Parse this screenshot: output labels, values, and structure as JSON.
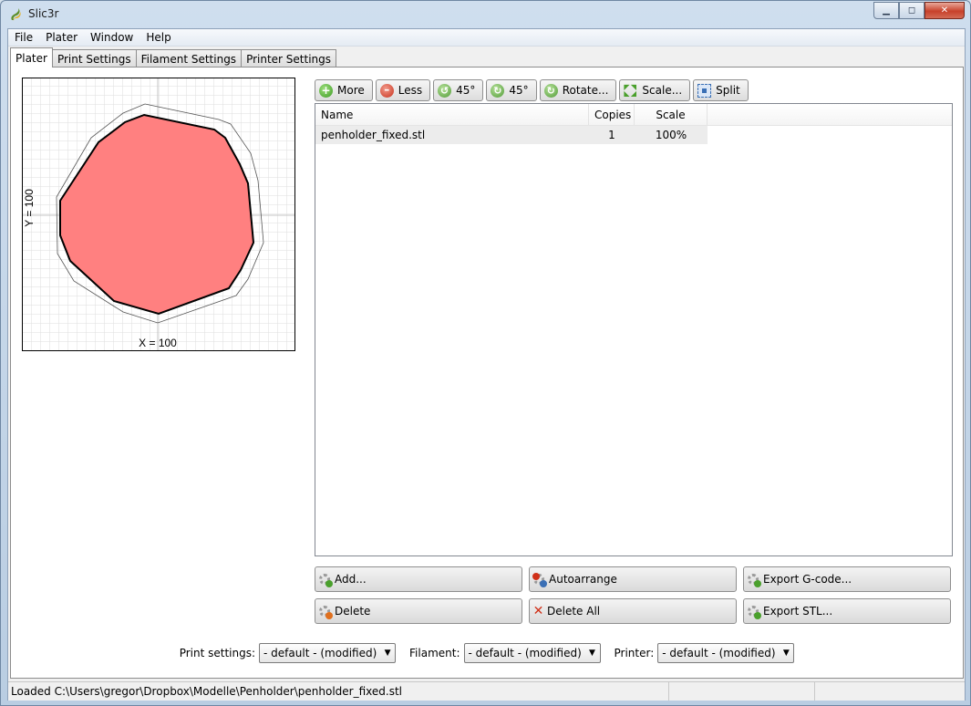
{
  "window": {
    "title": "Slic3r"
  },
  "menu": [
    "File",
    "Plater",
    "Window",
    "Help"
  ],
  "tabs": [
    {
      "label": "Plater",
      "active": true
    },
    {
      "label": "Print Settings",
      "active": false
    },
    {
      "label": "Filament Settings",
      "active": false
    },
    {
      "label": "Printer Settings",
      "active": false
    }
  ],
  "plater": {
    "x_label": "X = 100",
    "y_label": "Y = 100"
  },
  "toolbar": {
    "more": "More",
    "less": "Less",
    "rotate_left": "45°",
    "rotate_right": "45°",
    "rotate": "Rotate...",
    "scale": "Scale...",
    "split": "Split"
  },
  "list": {
    "columns": [
      "Name",
      "Copies",
      "Scale"
    ],
    "rows": [
      {
        "name": "penholder_fixed.stl",
        "copies": "1",
        "scale": "100%"
      }
    ]
  },
  "actions": {
    "add": "Add...",
    "autoarrange": "Autoarrange",
    "export_gcode": "Export G-code...",
    "delete": "Delete",
    "delete_all": "Delete All",
    "export_stl": "Export STL..."
  },
  "settings": {
    "print_label": "Print settings:",
    "print_value": "- default - (modified)",
    "filament_label": "Filament:",
    "filament_value": "- default - (modified)",
    "printer_label": "Printer:",
    "printer_value": "- default - (modified)"
  },
  "status": {
    "text": "Loaded C:\\Users\\gregor\\Dropbox\\Modelle\\Penholder\\penholder_fixed.stl"
  },
  "colors": {
    "object_fill": "#ff8080",
    "object_outline": "#000000",
    "grid": "#dddddd"
  }
}
